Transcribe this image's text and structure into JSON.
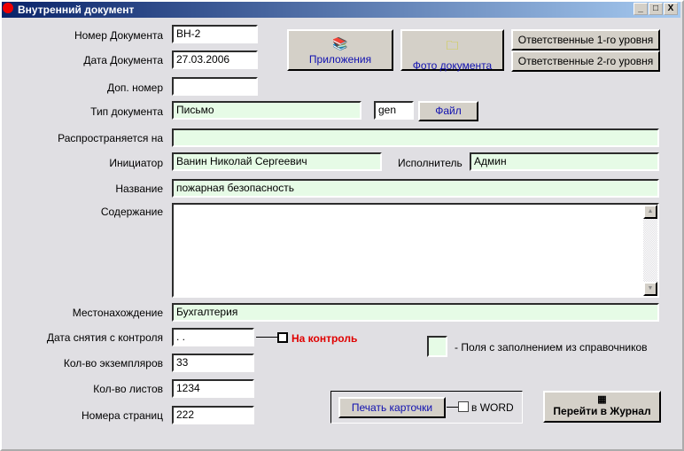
{
  "window": {
    "title": "Внутренний документ",
    "min": "_",
    "max": "□",
    "close": "X"
  },
  "labels": {
    "number": "Номер Документа",
    "date": "Дата Документа",
    "extra_number": "Доп. номер",
    "type": "Тип документа",
    "distributed": "Распространяется на",
    "initiator": "Инициатор",
    "executor": "Исполнитель",
    "name": "Название",
    "content": "Содержание",
    "location": "Местонахождение",
    "control_date": "Дата снятия  с контроля",
    "copies": "Кол-во экземпляров",
    "sheets": "Кол-во листов",
    "pages": "Номера страниц"
  },
  "values": {
    "number": "ВН-2",
    "date": "27.03.2006",
    "extra_number": "",
    "type": "Письмо",
    "type_code": "gen",
    "distributed": "",
    "initiator": "Ванин Николай Сергеевич",
    "executor": "Админ",
    "name": "пожарная безопасность",
    "content": "",
    "location": "Бухгалтерия",
    "control_date": " . .",
    "copies": "33",
    "sheets": "1234",
    "pages": "222"
  },
  "buttons": {
    "attachments": "Приложения",
    "photo": "Фото документа",
    "resp1": "Ответственные 1-го уровня",
    "resp2": "Ответственные 2-го уровня",
    "file": "Файл",
    "print": "Печать карточки",
    "journal": "Перейти в Журнал"
  },
  "checkboxes": {
    "control": "На контроль",
    "word": "в WORD"
  },
  "legend": "-  Поля с заполнением из справочников",
  "colors": {
    "lookup_field": "#e6fbe6",
    "control_text": "#e00000"
  }
}
